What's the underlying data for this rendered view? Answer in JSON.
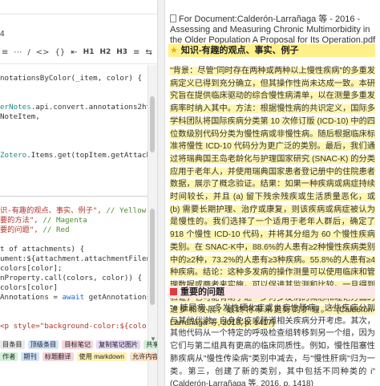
{
  "editor": {
    "number_label": "4",
    "toolbar": {
      "items": [
        "≡",
        "⋯",
        "/",
        "<>",
        "{}",
        "⇤",
        "H1",
        "H2",
        "H3",
        "≡",
        "⇆"
      ]
    },
    "code_top": [
      {
        "parts": [
          {
            "t": "fn",
            "s": "notationsByColor(_item, color) {"
          }
        ]
      },
      {
        "parts": [
          {
            "t": "fn",
            "s": ""
          }
        ]
      },
      {
        "parts": [
          {
            "t": "fn",
            "s": ""
          }
        ]
      },
      {
        "parts": [
          {
            "t": "teal",
            "s": "erNotes"
          },
          {
            "t": "fn",
            "s": ".api.convert.annotations2html(annots,"
          }
        ]
      },
      {
        "parts": [
          {
            "t": "fn",
            "s": "NoteItem,"
          }
        ]
      },
      {
        "parts": [
          {
            "t": "fn",
            "s": ""
          }
        ]
      },
      {
        "parts": [
          {
            "t": "fn",
            "s": ""
          }
        ]
      },
      {
        "parts": [
          {
            "t": "fn",
            "s": ""
          }
        ]
      },
      {
        "parts": [
          {
            "t": "teal",
            "s": "Zotero"
          },
          {
            "t": "fn",
            "s": ".Items.get(topItem.getAttachments()).fi"
          }
        ]
      },
      {
        "parts": [
          {
            "t": "fn",
            "s": ""
          }
        ]
      },
      {
        "parts": [
          {
            "t": "fn",
            "s": ""
          }
        ]
      }
    ],
    "code_bottom": [
      {
        "parts": [
          {
            "t": "str",
            "s": "识-有趣的观点、事实、例子\","
          },
          {
            "t": "cm",
            "s": " // Yellow"
          }
        ]
      },
      {
        "parts": [
          {
            "t": "str",
            "s": "要的方法\","
          },
          {
            "t": "cm",
            "s": " // Magenta"
          }
        ]
      },
      {
        "parts": [
          {
            "t": "str",
            "s": "要的问题\","
          },
          {
            "t": "cm",
            "s": " // Red"
          }
        ]
      },
      {
        "parts": [
          {
            "t": "fn",
            "s": ""
          }
        ]
      },
      {
        "parts": [
          {
            "t": "fn",
            "s": "t of attachments) {"
          }
        ]
      },
      {
        "parts": [
          {
            "t": "fn",
            "s": "ument:${attachment.attachmentFilename}`;"
          }
        ]
      },
      {
        "parts": [
          {
            "t": "fn",
            "s": "colors[color];"
          }
        ]
      },
      {
        "parts": [
          {
            "t": "fn",
            "s": "nProperty.call(colors, color)) {"
          }
        ]
      },
      {
        "parts": [
          {
            "t": "fn",
            "s": "colors[color]"
          }
        ]
      },
      {
        "parts": [
          {
            "t": "fn",
            "s": "Annotations = "
          },
          {
            "t": "kw",
            "s": "await"
          },
          {
            "t": "fn",
            "s": " getAnnotationsByColor("
          }
        ]
      },
      {
        "parts": [
          {
            "t": "fn",
            "s": ""
          }
        ]
      },
      {
        "parts": [
          {
            "t": "fn",
            "s": ""
          }
        ]
      },
      {
        "parts": [
          {
            "t": "str",
            "s": "<p style=\"background-color:${color}\">${"
          }
        ]
      }
    ],
    "buttons": [
      [
        {
          "label": "目条目",
          "cls": "b-gray"
        },
        {
          "label": "顶级条目",
          "cls": "b-blue"
        },
        {
          "label": "目标笔记",
          "cls": "b-pink"
        },
        {
          "label": "复制笔记图片",
          "cls": "b-purple"
        },
        {
          "label": "共享对象",
          "cls": "b-green"
        },
        {
          "label": "标题",
          "cls": "b-yellow"
        }
      ],
      [
        {
          "label": "作者",
          "cls": "b-green"
        },
        {
          "label": "期刊",
          "cls": "b-blue"
        },
        {
          "label": "标题翻译",
          "cls": "b-pink"
        },
        {
          "label": "使用 markdown",
          "cls": "b-yellow"
        },
        {
          "label": "允许内容刷新",
          "cls": "b-orange"
        }
      ]
    ]
  },
  "notes": {
    "doc_title": "For Document:Calderón-Larrañaga 等 - 2016 - Assessing and Measuring Chronic Multimorbidity in the Older Population A Proposal for Its Operation.pdf",
    "section1_title": "知识-有趣的观点、事实、例子",
    "section1_text": "\"背景：尽管\"同时存在两种或两种以上慢性疾病\"的多重发病定义已得到充分确立，但其操作性尚未达成一致。本研究旨在提供临床驱动的综合慢性病清单，以在测量多重发病率时纳入其中。方法：根据慢性病的共识定义，国际多学科团队将国际疾病分类第 10 次修订版 (ICD-10) 中的四位数级别代码分类为慢性病或非慢性病。随后根据临床标准将慢性 ICD-10 代码分为更广泛的类别。最后，我们通过将瑞典国王岛老龄化与护理国家研究 (SNAC-K) 的分类应用于老年人，并使用瑞典国家患者登记册中的住院患者数据，展示了概念验证。结果：如果一种疾病或病症持续时间较长，并且 (a) 留下残余残疾或生活质量恶化，或 (b) 需要长期护理、治疗或康复，则该疾病或病症被认为是慢性的。我们选择了一个适用于老年人群后，确定了 918 个慢性 ICD-10 代码，并将其分组为 60 个慢性疾病类别。在 SNAC-K中，88.6%的人患有≥2种慢性疾病类别中的≥2种，73.2%的人患有≥3种疾病。55.8%的人患有≥4种疾病。结论：这种多发病的操作测量可以使用临床和管理数据或两者来实施，可以促进其监测和比较。一旦得到验证，它可能有助于进一步对多发病的概念和理论方面的进步和发展，最终将带来更好的护理。\" (Calderón-Larrañaga 等, 2016, p. 1417)",
    "section2_title": "重要的问题",
    "section2_text": "\"e 糖尿病、多发性硬化症或炎症性肠病，这些疾病分到与其他代谢、自身免疫或肠道相关疾病分开考虑。其次，其他代码从一个特定的呼吸检查组转移到另一个组，因为它们与第二组具有更高的临床同质性。例如，慢性阻塞性肺疾病从\"慢性传染病\"类别中减去，与\"慢性肝病\"归为一类。第三，创建了新的类别，其中包括不同种类的 i\" (Calderón-Larrañaga 等, 2016, p. 1418)"
  },
  "colors": {
    "section1_bg": "#fff08a",
    "section2_bg": "#fce8e8",
    "red_marker": "#e23b3b",
    "link_blue": "#1a66d2"
  }
}
